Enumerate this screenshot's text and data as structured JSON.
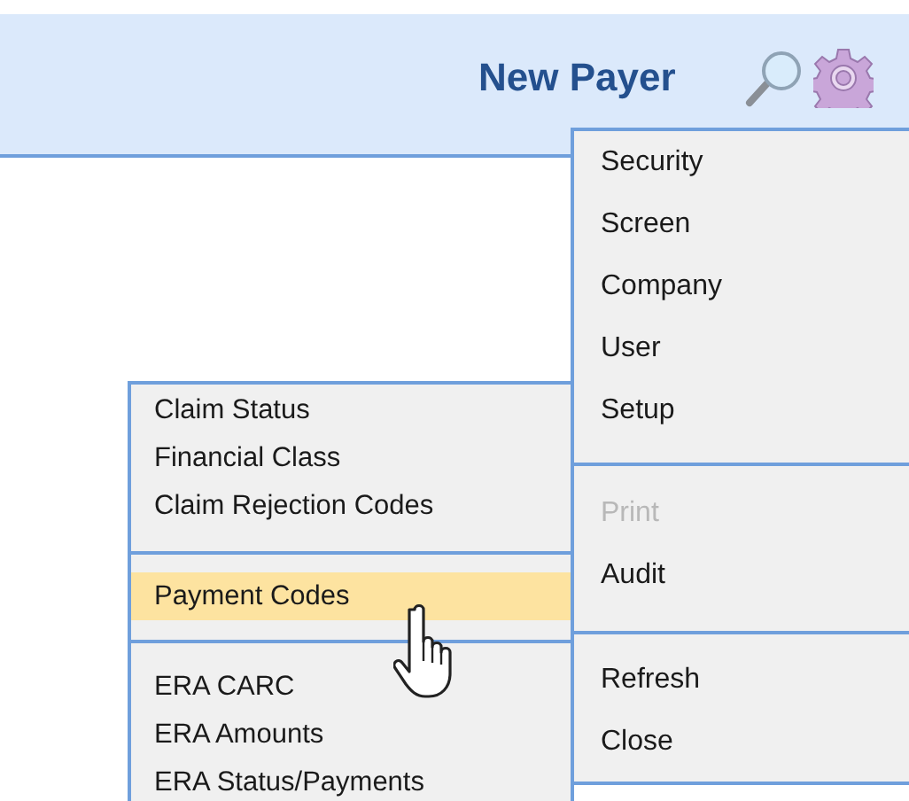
{
  "header": {
    "title": "New Payer"
  },
  "main_menu": {
    "groups": [
      {
        "items": [
          {
            "label": "Security",
            "disabled": false
          },
          {
            "label": "Screen",
            "disabled": false
          },
          {
            "label": "Company",
            "disabled": false
          },
          {
            "label": "User",
            "disabled": false
          },
          {
            "label": "Setup",
            "disabled": false
          }
        ]
      },
      {
        "items": [
          {
            "label": "Print",
            "disabled": true
          },
          {
            "label": "Audit",
            "disabled": false
          }
        ]
      },
      {
        "items": [
          {
            "label": "Refresh",
            "disabled": false
          },
          {
            "label": "Close",
            "disabled": false
          }
        ]
      }
    ]
  },
  "submenu": {
    "groups": [
      {
        "items": [
          {
            "label": "Claim Status",
            "selected": false
          },
          {
            "label": "Financial Class",
            "selected": false
          },
          {
            "label": "Claim Rejection Codes",
            "selected": false
          }
        ]
      },
      {
        "items": [
          {
            "label": "Payment Codes",
            "selected": true
          }
        ]
      },
      {
        "items": [
          {
            "label": "ERA CARC",
            "selected": false
          },
          {
            "label": "ERA Amounts",
            "selected": false
          },
          {
            "label": "ERA Status/Payments",
            "selected": false
          }
        ]
      }
    ]
  }
}
